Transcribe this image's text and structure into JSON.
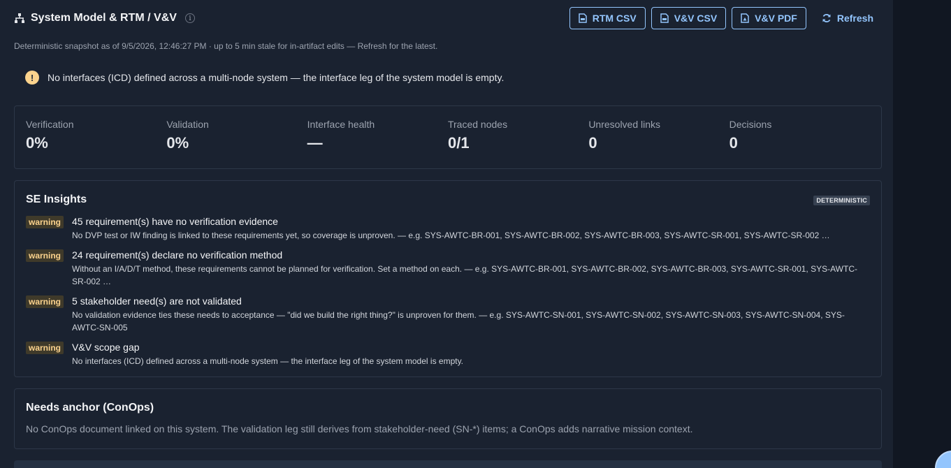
{
  "header": {
    "title": "System Model & RTM / V&V",
    "info_glyph": "i",
    "buttons": {
      "rtm_csv": "RTM CSV",
      "vv_csv": "V&V CSV",
      "vv_pdf": "V&V PDF",
      "refresh": "Refresh"
    }
  },
  "subtitle": "Deterministic snapshot as of 9/5/2026, 12:46:27 PM · up to 5 min stale for in-artifact edits — Refresh for the latest.",
  "alert": {
    "glyph": "!",
    "text": "No interfaces (ICD) defined across a multi-node system — the interface leg of the system model is empty."
  },
  "stats": [
    {
      "label": "Verification",
      "value": "0%"
    },
    {
      "label": "Validation",
      "value": "0%"
    },
    {
      "label": "Interface health",
      "value": "—"
    },
    {
      "label": "Traced nodes",
      "value": "0/1"
    },
    {
      "label": "Unresolved links",
      "value": "0"
    },
    {
      "label": "Decisions",
      "value": "0"
    }
  ],
  "insights": {
    "title": "SE Insights",
    "badge": "DETERMINISTIC",
    "items": [
      {
        "severity": "warning",
        "headline": "45 requirement(s) have no verification evidence",
        "description": "No DVP test or IW finding is linked to these requirements yet, so coverage is unproven. — e.g. SYS-AWTC-BR-001, SYS-AWTC-BR-002, SYS-AWTC-BR-003, SYS-AWTC-SR-001, SYS-AWTC-SR-002 …"
      },
      {
        "severity": "warning",
        "headline": "24 requirement(s) declare no verification method",
        "description": "Without an I/A/D/T method, these requirements cannot be planned for verification. Set a method on each. — e.g. SYS-AWTC-BR-001, SYS-AWTC-BR-002, SYS-AWTC-BR-003, SYS-AWTC-SR-001, SYS-AWTC-SR-002 …"
      },
      {
        "severity": "warning",
        "headline": "5 stakeholder need(s) are not validated",
        "description": "No validation evidence ties these needs to acceptance — \"did we build the right thing?\" is unproven for them. — e.g. SYS-AWTC-SN-001, SYS-AWTC-SN-002, SYS-AWTC-SN-003, SYS-AWTC-SN-004, SYS-AWTC-SN-005"
      },
      {
        "severity": "warning",
        "headline": "V&V scope gap",
        "description": "No interfaces (ICD) defined across a multi-node system — the interface leg of the system model is empty."
      }
    ]
  },
  "conops": {
    "title": "Needs anchor (ConOps)",
    "text": "No ConOps document linked on this system. The validation leg still derives from stakeholder-need (SN-*) items; a ConOps adds narrative mission context."
  },
  "colors": {
    "accent": "#93c5fd",
    "warning_bg": "#3f3a2a",
    "warning_fg": "#fcd38d",
    "panel_bg": "#1a2230"
  }
}
